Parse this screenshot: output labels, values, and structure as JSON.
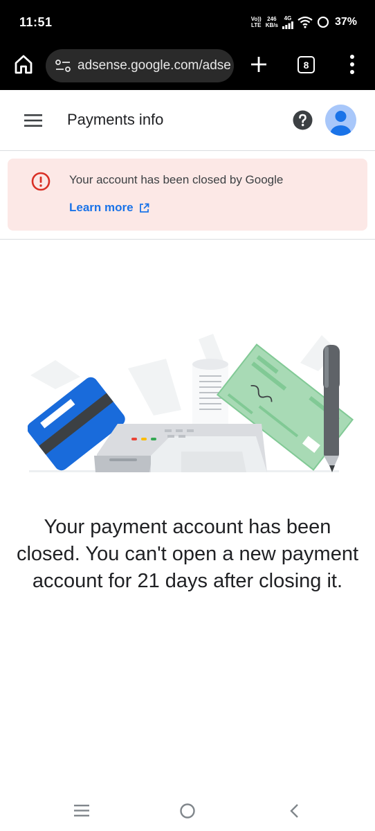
{
  "status_bar": {
    "time": "11:51",
    "volte_top": "Vo))",
    "volte_bottom": "LTE",
    "speed_top": "246",
    "speed_bottom": "KB/s",
    "network": "4G",
    "battery_percent": "37%"
  },
  "browser": {
    "url": "adsense.google.com/adse",
    "tab_count": "8",
    "icons": [
      "home-icon",
      "site-settings-icon",
      "new-tab-icon",
      "tab-switcher-icon",
      "more-vert-icon"
    ]
  },
  "header": {
    "title": "Payments info",
    "icons": [
      "menu-icon",
      "help-icon",
      "account-avatar"
    ]
  },
  "alert": {
    "message": "Your account has been closed by Google",
    "link_label": "Learn more",
    "icon": "error-icon",
    "link_icon": "open-in-new-icon",
    "colors": {
      "background": "#fce8e6",
      "icon": "#d93025",
      "link": "#1a73e8"
    }
  },
  "main": {
    "message": "Your payment account has been closed. You can't open a new payment account for 21 days after closing it."
  },
  "nav_bar": {
    "icons": [
      "recents-icon",
      "home-circle-icon",
      "back-icon"
    ]
  },
  "colors": {
    "accent": "#1a73e8",
    "avatar": "#4285f4"
  }
}
